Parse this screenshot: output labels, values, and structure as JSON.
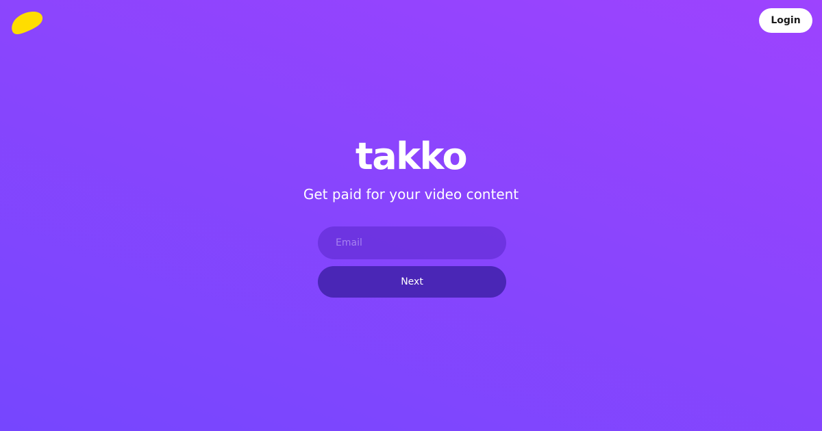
{
  "header": {
    "logo_icon": "yellow-blob-logo-icon",
    "logo_color": "#ffdd00",
    "login_label": "Login"
  },
  "hero": {
    "brand": "takko",
    "tagline": "Get paid for your video content"
  },
  "form": {
    "email_placeholder": "Email",
    "email_value": "",
    "next_label": "Next"
  },
  "colors": {
    "background_top_right": "#9d43fe",
    "background_bottom_left": "#7646fe",
    "next_button": "#4a26b6",
    "login_button": "#ffffff"
  }
}
